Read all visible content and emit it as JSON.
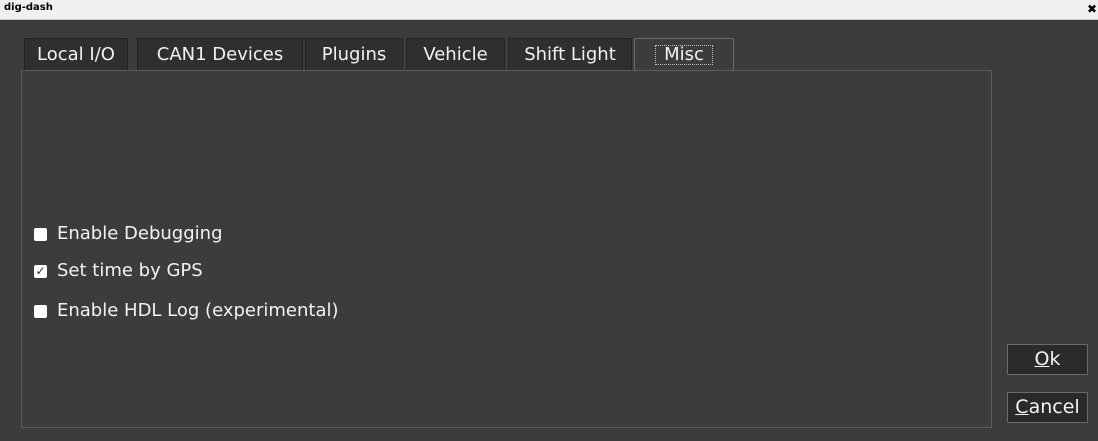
{
  "window": {
    "title": "dig-dash",
    "close_glyph": "✖"
  },
  "tabs": [
    {
      "label": "Local I/O",
      "active": false
    },
    {
      "label": "CAN1 Devices",
      "active": false
    },
    {
      "label": "Plugins",
      "active": false
    },
    {
      "label": "Vehicle",
      "active": false
    },
    {
      "label": "Shift Light",
      "active": false
    },
    {
      "label": "Misc",
      "active": true
    }
  ],
  "options": [
    {
      "label": "Enable Debugging",
      "checked": false
    },
    {
      "label": "Set time by GPS",
      "checked": true
    },
    {
      "label": "Enable HDL Log (experimental)",
      "checked": false
    }
  ],
  "buttons": {
    "ok": {
      "mnemonic": "O",
      "rest": "k"
    },
    "cancel": {
      "mnemonic": "C",
      "rest": "ancel"
    }
  },
  "icons": {
    "close": "close-icon",
    "check": "checkmark-icon"
  },
  "colors": {
    "background": "#3c3c3c",
    "tab_inactive": "#2f2f2f",
    "button": "#2a2a2a",
    "text": "#f2f2f2"
  }
}
